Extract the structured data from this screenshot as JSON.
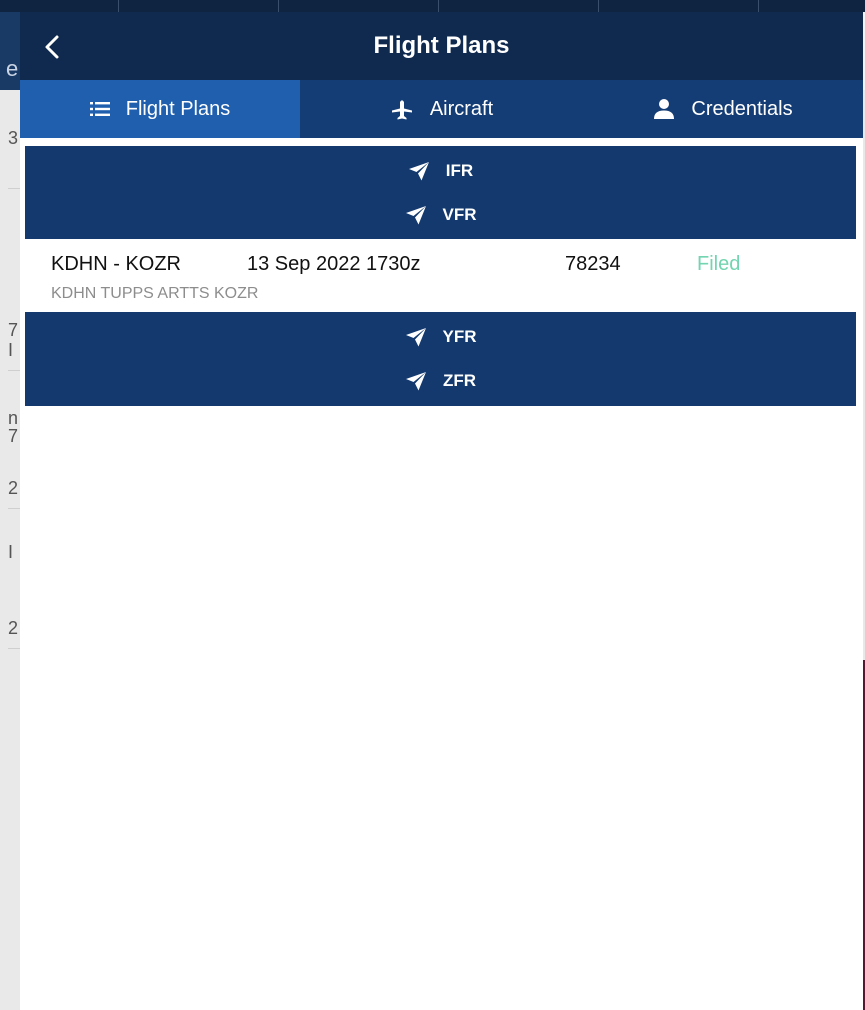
{
  "header": {
    "title": "Flight Plans",
    "back_icon": "chevron-left-icon"
  },
  "tabs": [
    {
      "label": "Flight Plans",
      "icon": "list-icon",
      "selected": true
    },
    {
      "label": "Aircraft",
      "icon": "airplane-icon",
      "selected": false
    },
    {
      "label": "Credentials",
      "icon": "person-icon",
      "selected": false
    }
  ],
  "sections": [
    {
      "label": "IFR",
      "icon": "paper-plane-icon"
    },
    {
      "label": "VFR",
      "icon": "paper-plane-icon"
    },
    {
      "label": "YFR",
      "icon": "paper-plane-icon"
    },
    {
      "label": "ZFR",
      "icon": "paper-plane-icon"
    }
  ],
  "flight_plans": [
    {
      "route": "KDHN - KOZR",
      "date": "13 Sep 2022 1730z",
      "id": "78234",
      "status": "Filed",
      "waypoints": "KDHN TUPPS ARTTS KOZR"
    }
  ],
  "background": {
    "header_fragment": "e",
    "fragments": [
      "3",
      "7",
      "I",
      "n",
      "7",
      "2",
      "I",
      "2"
    ]
  },
  "colors": {
    "nav_bar": "#10294f",
    "tab_bar": "#153d75",
    "tab_selected": "#1f5fae",
    "section_header": "#13396e",
    "status_filed": "#72d4b0",
    "waypoints_text": "#8d8d8d"
  }
}
